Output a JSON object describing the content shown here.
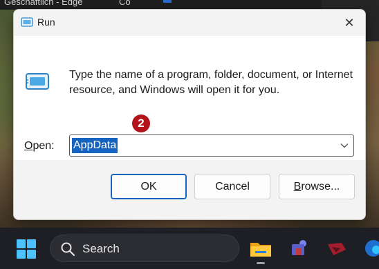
{
  "background": {
    "window_title_fragment": "Geschäftlich - Edge",
    "window_title_fragment2": "Co"
  },
  "dialog": {
    "title": "Run",
    "close_label": "✕",
    "message": "Type the name of a program, folder, document, or Internet resource, and Windows will open it for you.",
    "open_label_mnemonic": "O",
    "open_label_rest": "pen:",
    "open_value": "AppData",
    "step_badge": "2",
    "buttons": {
      "ok": "OK",
      "cancel": "Cancel",
      "browse_mnemonic": "B",
      "browse_rest": "rowse..."
    }
  },
  "taskbar": {
    "search_text": "Search",
    "icons": [
      "windows-start-icon",
      "search-icon",
      "file-explorer-icon",
      "teams-icon",
      "app-icon",
      "edge-icon"
    ]
  },
  "colors": {
    "accent": "#1565c0",
    "badge": "#b3141a",
    "start": "#4cc2ff"
  }
}
